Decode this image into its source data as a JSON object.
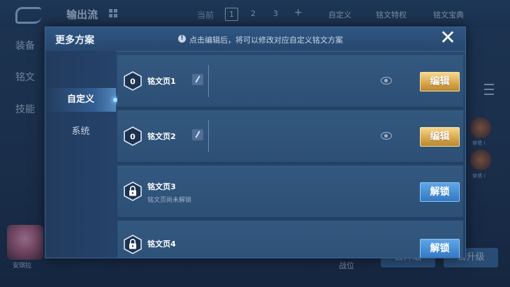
{
  "background": {
    "title": "输出流",
    "current_label": "当前",
    "pages": [
      "1",
      "2",
      "3"
    ],
    "add_label": "+",
    "top_links": [
      "自定义",
      "铭文特权",
      "铭文宝典"
    ],
    "side_tabs": [
      "装备",
      "铭文",
      "技能"
    ],
    "rune_labels": [
      "穿墙 I",
      "穿墙 I"
    ],
    "hero_name": "安琪拉",
    "bottom_buttons": [
      "去升级",
      "去升级"
    ],
    "misc_text": "战位"
  },
  "modal": {
    "title": "更多方案",
    "hint": "点击编辑后，将可以修改对应自定义铭文方案",
    "close_label": "✕",
    "nav": [
      "自定义",
      "系统"
    ],
    "pages": [
      {
        "name": "铭文页1",
        "badge": "0",
        "button": "编辑"
      },
      {
        "name": "铭文页2",
        "badge": "0",
        "button": "编辑"
      },
      {
        "name": "铭文页3",
        "sub": "铭文页尚未解锁",
        "button": "解锁"
      },
      {
        "name": "铭文页4",
        "button": "解锁"
      }
    ]
  }
}
